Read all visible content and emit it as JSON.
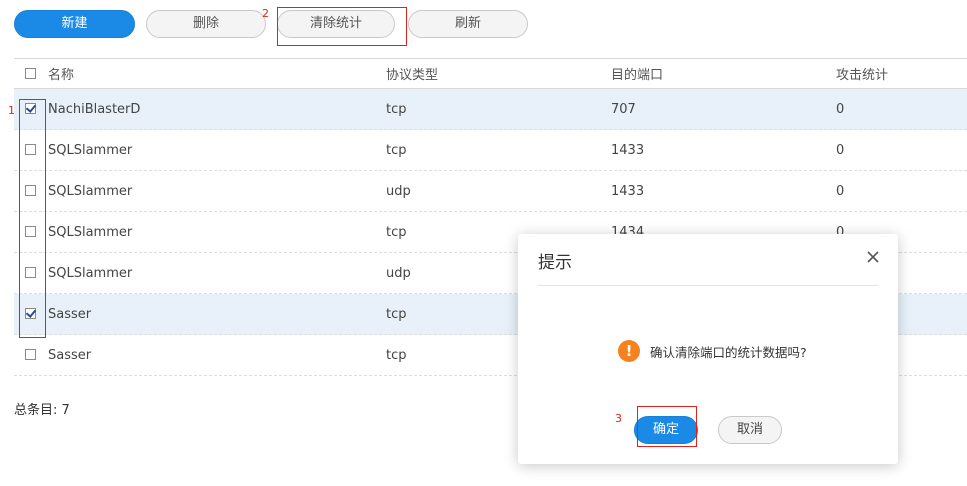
{
  "toolbar": {
    "new_label": "新建",
    "delete_label": "删除",
    "clear_stats_label": "清除统计",
    "refresh_label": "刷新"
  },
  "annotations": {
    "one": "1",
    "two": "2",
    "three": "3"
  },
  "table": {
    "headers": [
      "名称",
      "协议类型",
      "目的端口",
      "攻击统计"
    ],
    "rows": [
      {
        "name": "NachiBlasterD",
        "protocol": "tcp",
        "port": "707",
        "attacks": "0",
        "checked": true
      },
      {
        "name": "SQLSlammer",
        "protocol": "tcp",
        "port": "1433",
        "attacks": "0",
        "checked": false
      },
      {
        "name": "SQLSlammer",
        "protocol": "udp",
        "port": "1433",
        "attacks": "0",
        "checked": false
      },
      {
        "name": "SQLSlammer",
        "protocol": "tcp",
        "port": "1434",
        "attacks": "0",
        "checked": false
      },
      {
        "name": "SQLSlammer",
        "protocol": "udp",
        "port": "",
        "attacks": "",
        "checked": false
      },
      {
        "name": "Sasser",
        "protocol": "tcp",
        "port": "",
        "attacks": "",
        "checked": true
      },
      {
        "name": "Sasser",
        "protocol": "tcp",
        "port": "",
        "attacks": "",
        "checked": false
      }
    ]
  },
  "footer": {
    "total": "总条目: 7"
  },
  "dialog": {
    "title": "提示",
    "message": "确认清除端口的统计数据吗?",
    "ok_label": "确定",
    "cancel_label": "取消"
  },
  "colors": {
    "primary": "#1a8ae6",
    "annotation": "#e0221c",
    "warning": "#f5821f",
    "selected_row": "#e8f1f9"
  }
}
